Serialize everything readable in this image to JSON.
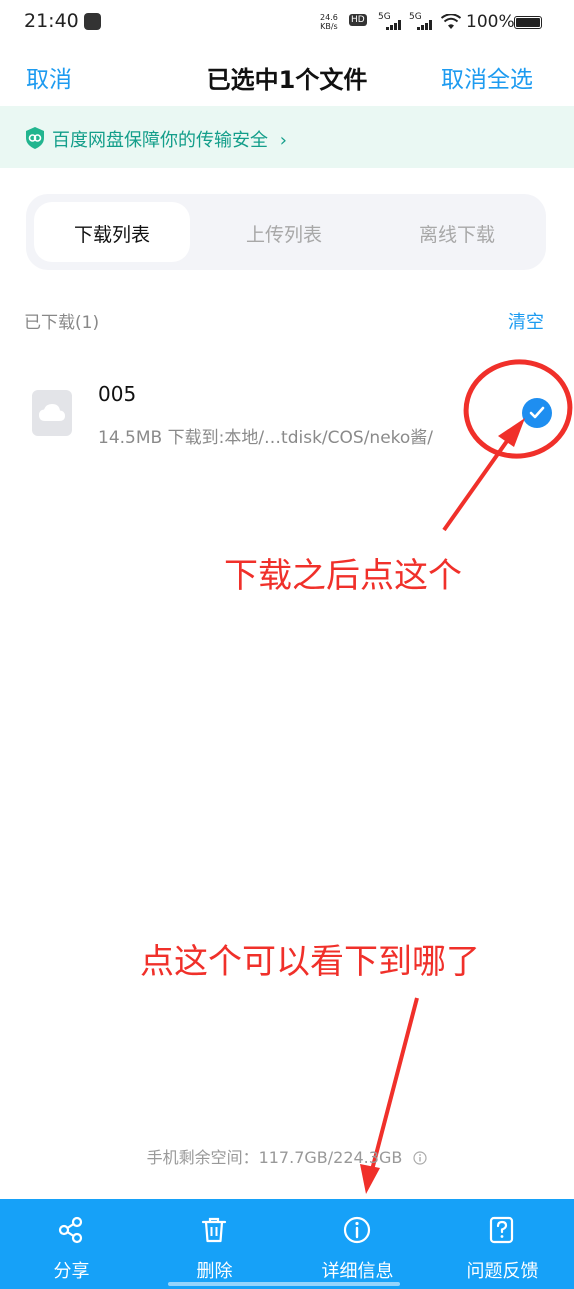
{
  "status_bar": {
    "time": "21:40",
    "net_speed_value": "24.6",
    "net_speed_unit": "KB/s",
    "hd_label": "HD",
    "signal_1": "5G",
    "signal_2": "5G",
    "battery": "100%"
  },
  "top_bar": {
    "cancel_label": "取消",
    "title": "已选中1个文件",
    "deselect_all_label": "取消全选"
  },
  "banner": {
    "text": "百度网盘保障你的传输安全",
    "chevron": "›"
  },
  "tabs": [
    {
      "label": "下载列表",
      "active": true
    },
    {
      "label": "上传列表",
      "active": false
    },
    {
      "label": "离线下载",
      "active": false
    }
  ],
  "section": {
    "title": "已下载(1)",
    "clear_label": "清空"
  },
  "files": [
    {
      "name": "005",
      "info": "14.5MB 下载到:本地/…tdisk/COS/neko酱/",
      "checked": true,
      "icon": "cloud-file-icon"
    }
  ],
  "annotations": {
    "note_1": "下载之后点这个",
    "note_2": "点这个可以看下到哪了"
  },
  "storage": {
    "text": "手机剩余空间：117.7GB/224.3GB"
  },
  "toolbar": [
    {
      "label": "分享",
      "icon": "share-icon"
    },
    {
      "label": "删除",
      "icon": "trash-icon"
    },
    {
      "label": "详细信息",
      "icon": "info-icon"
    },
    {
      "label": "问题反馈",
      "icon": "feedback-icon"
    }
  ],
  "colors": {
    "accent": "#1d9bf0",
    "toolbar_bg": "#16a1f8",
    "banner_text": "#139e8a",
    "annotation": "#f0302a"
  }
}
